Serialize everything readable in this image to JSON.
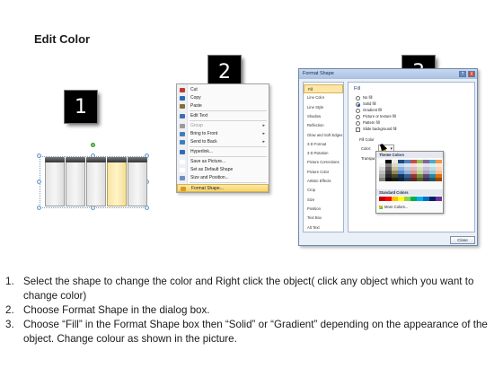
{
  "title": "Edit Color",
  "badges": [
    "1",
    "2",
    "3"
  ],
  "context_menu": {
    "items": [
      {
        "label": "Cut",
        "disabled": false,
        "arrow": false,
        "color": "#c0392b"
      },
      {
        "label": "Copy",
        "disabled": false,
        "arrow": false,
        "color": "#2b6cb0"
      },
      {
        "label": "Paste",
        "disabled": false,
        "arrow": false,
        "color": "#8a6d2f"
      },
      {
        "label": "Edit Text",
        "disabled": false,
        "arrow": false,
        "color": "#3f6fb0"
      },
      {
        "label": "Group",
        "disabled": true,
        "arrow": true,
        "color": "#9a9a9a"
      },
      {
        "label": "Bring to Front",
        "disabled": false,
        "arrow": true,
        "color": "#3f7fb8"
      },
      {
        "label": "Send to Back",
        "disabled": false,
        "arrow": true,
        "color": "#3f7fb8"
      },
      {
        "label": "Hyperlink...",
        "disabled": false,
        "arrow": false,
        "color": "#2f6db3"
      },
      {
        "label": "Save as Picture...",
        "disabled": false,
        "arrow": false,
        "color": "#ffffff"
      },
      {
        "label": "Set as Default Shape",
        "disabled": false,
        "arrow": false,
        "color": "#ffffff"
      },
      {
        "label": "Size and Position...",
        "disabled": false,
        "arrow": false,
        "color": "#6b8fc2"
      },
      {
        "label": "Format Shape...",
        "disabled": false,
        "arrow": false,
        "color": "#d89a2a"
      }
    ]
  },
  "dialog": {
    "title": "Format Shape",
    "help_button": "?",
    "close_button": "X",
    "nav": [
      "Fill",
      "Line Color",
      "Line Style",
      "Shadow",
      "Reflection",
      "Glow and Soft Edges",
      "3-D Format",
      "3-D Rotation",
      "Picture Corrections",
      "Picture Color",
      "Artistic Effects",
      "Crop",
      "Size",
      "Position",
      "Text Box",
      "Alt Text"
    ],
    "fill_heading": "Fill",
    "options": [
      "No fill",
      "Solid fill",
      "Gradient fill",
      "Picture or texture fill",
      "Pattern fill"
    ],
    "slide_background": "Slide background fill",
    "fill_color_label": "Fill Color",
    "color_label": "Color:",
    "transparency_label": "Transpa",
    "close_label": "Close"
  },
  "palette": {
    "theme_heading": "Theme Colors",
    "standard_heading": "Standard Colors",
    "more_colors": "More Colors...",
    "theme_colors": [
      [
        "#ffffff",
        "#f2f2f2",
        "#d9d9d9",
        "#bfbfbf",
        "#a6a6a6",
        "#808080"
      ],
      [
        "#000000",
        "#7f7f7f",
        "#595959",
        "#3f3f3f",
        "#262626",
        "#0d0d0d"
      ],
      [
        "#eeece1",
        "#ddd9c3",
        "#c4bd97",
        "#948a54",
        "#4a452a",
        "#1e1c11"
      ],
      [
        "#1f497d",
        "#c6d9f0",
        "#8db3e2",
        "#548dd4",
        "#17365d",
        "#0f243e"
      ],
      [
        "#4f81bd",
        "#dbe5f1",
        "#b8cce4",
        "#95b3d7",
        "#366092",
        "#244061"
      ],
      [
        "#c0504d",
        "#f2dcdb",
        "#e5b9b7",
        "#d99694",
        "#953734",
        "#632423"
      ],
      [
        "#9bbb59",
        "#ebf1dd",
        "#d7e3bc",
        "#c3d69b",
        "#76923c",
        "#4f6128"
      ],
      [
        "#8064a2",
        "#e5e0ec",
        "#ccc1d9",
        "#b2a2c7",
        "#5f497a",
        "#3f3151"
      ],
      [
        "#4bacc6",
        "#dbeef3",
        "#b7dde8",
        "#92cddc",
        "#31859b",
        "#205867"
      ],
      [
        "#f79646",
        "#fdeada",
        "#fbd5b5",
        "#fac08f",
        "#e36c09",
        "#974806"
      ]
    ],
    "standard_colors": [
      "#c00000",
      "#ff0000",
      "#ffc000",
      "#ffff00",
      "#92d050",
      "#00b050",
      "#00b0f0",
      "#0070c0",
      "#002060",
      "#7030a0"
    ]
  },
  "steps": [
    {
      "num": "1.",
      "text": "Select the shape to change the color and Right click the object( click any object which you want to change color)"
    },
    {
      "num": "2.",
      "text": "Choose Format Shape in the dialog box."
    },
    {
      "num": "3.",
      "text": "Choose “Fill” in the Format Shape box then “Solid” or “Gradient” depending on the appearance of the object. Change colour as shown in the picture."
    }
  ]
}
